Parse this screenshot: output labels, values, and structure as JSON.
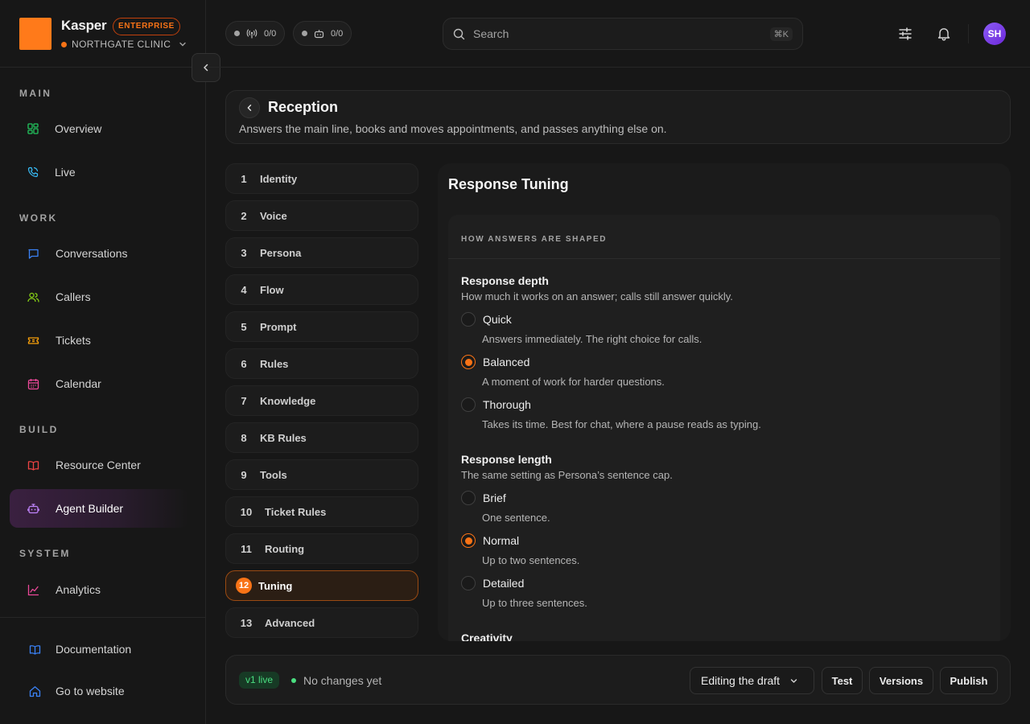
{
  "brand": {
    "name": "Kasper",
    "badge": "ENTERPRISE",
    "org": "NORTHGATE CLINIC"
  },
  "status": {
    "channels_count": "0/0",
    "agents_count": "0/0"
  },
  "search": {
    "placeholder": "Search",
    "shortcut": "⌘K"
  },
  "user": {
    "initials": "SH"
  },
  "sidebar": {
    "sections": {
      "main": "MAIN",
      "work": "WORK",
      "build": "BUILD",
      "system": "SYSTEM"
    },
    "items": {
      "overview": "Overview",
      "live": "Live",
      "conversations": "Conversations",
      "callers": "Callers",
      "tickets": "Tickets",
      "calendar": "Calendar",
      "resource_center": "Resource Center",
      "agent_builder": "Agent Builder",
      "analytics": "Analytics"
    },
    "footer": {
      "documentation": "Documentation",
      "website": "Go to website"
    }
  },
  "page": {
    "title": "Reception",
    "subtitle": "Answers the main line, books and moves appointments, and passes anything else on."
  },
  "steps": [
    {
      "num": "1",
      "label": "Identity"
    },
    {
      "num": "2",
      "label": "Voice"
    },
    {
      "num": "3",
      "label": "Persona"
    },
    {
      "num": "4",
      "label": "Flow"
    },
    {
      "num": "5",
      "label": "Prompt"
    },
    {
      "num": "6",
      "label": "Rules"
    },
    {
      "num": "7",
      "label": "Knowledge"
    },
    {
      "num": "8",
      "label": "KB Rules"
    },
    {
      "num": "9",
      "label": "Tools"
    },
    {
      "num": "10",
      "label": "Ticket Rules"
    },
    {
      "num": "11",
      "label": "Routing"
    },
    {
      "num": "12",
      "label": "Tuning"
    },
    {
      "num": "13",
      "label": "Advanced"
    }
  ],
  "active_step": "12",
  "tuning": {
    "title": "Response Tuning",
    "card_heading": "HOW ANSWERS ARE SHAPED",
    "depth": {
      "title": "Response depth",
      "desc": "How much it works on an answer; calls still answer quickly.",
      "selected": "Balanced",
      "options": [
        {
          "label": "Quick",
          "desc": "Answers immediately. The right choice for calls."
        },
        {
          "label": "Balanced",
          "desc": "A moment of work for harder questions."
        },
        {
          "label": "Thorough",
          "desc": "Takes its time. Best for chat, where a pause reads as typing."
        }
      ]
    },
    "length": {
      "title": "Response length",
      "desc": "The same setting as Persona’s sentence cap.",
      "selected": "Normal",
      "options": [
        {
          "label": "Brief",
          "desc": "One sentence."
        },
        {
          "label": "Normal",
          "desc": "Up to two sentences."
        },
        {
          "label": "Detailed",
          "desc": "Up to three sentences."
        }
      ]
    },
    "creativity_title": "Creativity"
  },
  "footer_bar": {
    "live_badge": "v1 live",
    "changes": "No changes yet",
    "mode": "Editing the draft",
    "test": "Test",
    "versions": "Versions",
    "publish": "Publish"
  },
  "colors": {
    "accent": "#f97316",
    "brand": "#ff7a1a",
    "live": "#4ade80"
  }
}
